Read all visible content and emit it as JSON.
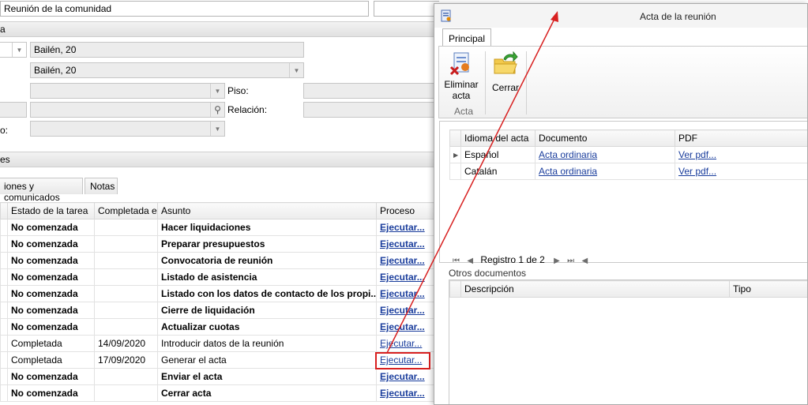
{
  "meeting_title": "Reunión de la comunidad",
  "section_1": "a",
  "address_1": "Bailén, 20",
  "address_2": "Bailén, 20",
  "label_piso": "Piso:",
  "label_relacion": "Relación:",
  "label_cut": "o:",
  "section_2": "es",
  "tabs": [
    "iones y comunicados",
    "Notas"
  ],
  "tasks": {
    "headers": [
      "Estado de la tarea",
      "Completada el",
      "Asunto",
      "Proceso"
    ],
    "rows": [
      {
        "estado": "No comenzada",
        "fecha": "",
        "asunto": "Hacer liquidaciones",
        "proceso": "Ejecutar...",
        "bold": true
      },
      {
        "estado": "No comenzada",
        "fecha": "",
        "asunto": "Preparar presupuestos",
        "proceso": "Ejecutar...",
        "bold": true
      },
      {
        "estado": "No comenzada",
        "fecha": "",
        "asunto": "Convocatoria de reunión",
        "proceso": "Ejecutar...",
        "bold": true
      },
      {
        "estado": "No comenzada",
        "fecha": "",
        "asunto": "Listado de asistencia",
        "proceso": "Ejecutar...",
        "bold": true
      },
      {
        "estado": "No comenzada",
        "fecha": "",
        "asunto": "Listado con los datos de contacto de los propi...",
        "proceso": "Ejecutar...",
        "bold": true
      },
      {
        "estado": "No comenzada",
        "fecha": "",
        "asunto": "Cierre de liquidación",
        "proceso": "Ejecutar...",
        "bold": true
      },
      {
        "estado": "No comenzada",
        "fecha": "",
        "asunto": "Actualizar cuotas",
        "proceso": "Ejecutar...",
        "bold": true
      },
      {
        "estado": "Completada",
        "fecha": "14/09/2020",
        "asunto": "Introducir datos de la reunión",
        "proceso": "Ejecutar...",
        "bold": false
      },
      {
        "estado": "Completada",
        "fecha": "17/09/2020",
        "asunto": "Generar el acta",
        "proceso": "Ejecutar...",
        "bold": false
      },
      {
        "estado": "No comenzada",
        "fecha": "",
        "asunto": "Enviar el acta",
        "proceso": "Ejecutar...",
        "bold": true
      },
      {
        "estado": "No comenzada",
        "fecha": "",
        "asunto": "Cerrar acta",
        "proceso": "Ejecutar...",
        "bold": true
      }
    ]
  },
  "dialog": {
    "title": "Acta de la reunión",
    "ribbon_tab": "Principal",
    "btn_delete_line1": "Eliminar",
    "btn_delete_line2": "acta",
    "btn_close": "Cerrar",
    "group_label": "Acta",
    "acts": {
      "headers": [
        "Idioma del acta",
        "Documento",
        "PDF"
      ],
      "rows": [
        {
          "idioma": "Español",
          "documento": "Acta ordinaria",
          "pdf": "Ver pdf..."
        },
        {
          "idioma": "Catalán",
          "documento": "Acta ordinaria",
          "pdf": "Ver pdf..."
        }
      ]
    },
    "record_nav": "Registro 1 de 2",
    "other_docs_label": "Otros documentos",
    "other_headers": [
      "Descripción",
      "Tipo"
    ]
  },
  "colors": {
    "highlight": "#d82020",
    "link": "#1a3d9c"
  }
}
